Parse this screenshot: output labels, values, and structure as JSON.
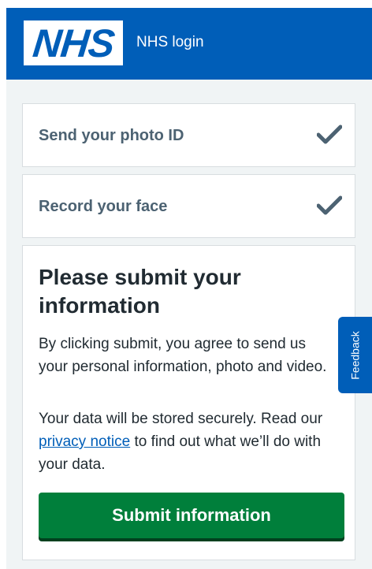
{
  "header": {
    "logo_text": "NHS",
    "service_name": "NHS login"
  },
  "steps": [
    {
      "label": "Send your photo ID",
      "status_icon": "check-icon"
    },
    {
      "label": "Record your face",
      "status_icon": "check-icon"
    }
  ],
  "submit_card": {
    "heading": "Please submit your information",
    "paragraph_1": "By clicking submit, you agree to send us your personal information, photo and video.",
    "paragraph_2_before": "Your data will be stored securely. Read our ",
    "paragraph_2_link": "privacy notice",
    "paragraph_2_after": " to find out what we’ll do with your data.",
    "button_label": "Submit information"
  },
  "feedback": {
    "label": "Feedback"
  },
  "colors": {
    "nhs_blue": "#005eb8",
    "button_green": "#007f3b",
    "page_background": "#f0f4f5",
    "step_text": "#4c6272"
  }
}
